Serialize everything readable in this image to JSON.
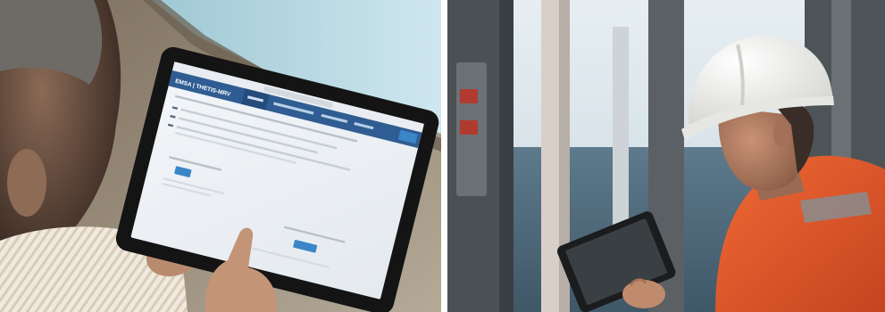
{
  "tablet_screen": {
    "header_brand": "EMSA | THETIS-MRV",
    "nav_tabs": [
      "",
      "",
      ""
    ],
    "browser_url": ""
  },
  "colors": {
    "nav_blue": "#2f5d93",
    "nav_blue_dark": "#244b7a",
    "button_blue": "#3a86c8",
    "coverall_orange": "#e2552a",
    "helmet_white": "#f1f1ee"
  }
}
